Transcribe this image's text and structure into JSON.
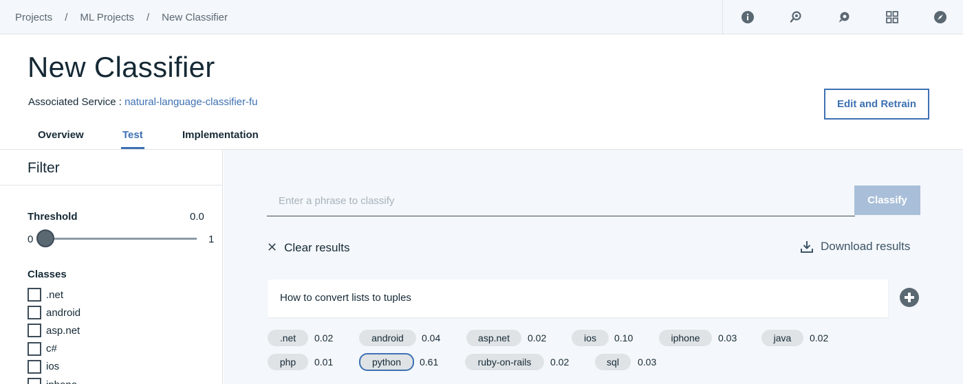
{
  "breadcrumb": {
    "items": [
      "Projects",
      "ML Projects",
      "New Classifier"
    ],
    "separator": "/"
  },
  "top_icons": [
    "info-icon",
    "deploy-icon",
    "support-icon",
    "apps-grid-icon",
    "compass-icon"
  ],
  "header": {
    "title": "New Classifier",
    "service_label": "Associated Service :",
    "service_link": "natural-language-classifier-fu",
    "retrain_button": "Edit and Retrain"
  },
  "tabs": [
    {
      "label": "Overview",
      "active": false
    },
    {
      "label": "Test",
      "active": true
    },
    {
      "label": "Implementation",
      "active": false
    }
  ],
  "filter": {
    "title": "Filter",
    "threshold_label": "Threshold",
    "threshold_value": "0.0",
    "slider_min": "0",
    "slider_max": "1",
    "slider_level": 0.0,
    "classes_label": "Classes",
    "classes": [
      ".net",
      "android",
      "asp.net",
      "c#",
      "ios",
      "iphone"
    ]
  },
  "test": {
    "phrase_placeholder": "Enter a phrase to classify",
    "classify_button": "Classify",
    "clear_results": "Clear results",
    "download_results": "Download results",
    "result_phrase": "How to convert lists to tuples",
    "scores": [
      {
        "label": ".net",
        "score": "0.02"
      },
      {
        "label": "android",
        "score": "0.04"
      },
      {
        "label": "asp.net",
        "score": "0.02"
      },
      {
        "label": "ios",
        "score": "0.10"
      },
      {
        "label": "iphone",
        "score": "0.03"
      },
      {
        "label": "java",
        "score": "0.02"
      },
      {
        "label": "php",
        "score": "0.01"
      },
      {
        "label": "python",
        "score": "0.61",
        "selected": true
      },
      {
        "label": "ruby-on-rails",
        "score": "0.02"
      },
      {
        "label": "sql",
        "score": "0.03"
      }
    ]
  },
  "colors": {
    "accent": "#3d70b2",
    "classify_disabled": "#a9bfd9",
    "main_bg": "#f4f7fb"
  }
}
